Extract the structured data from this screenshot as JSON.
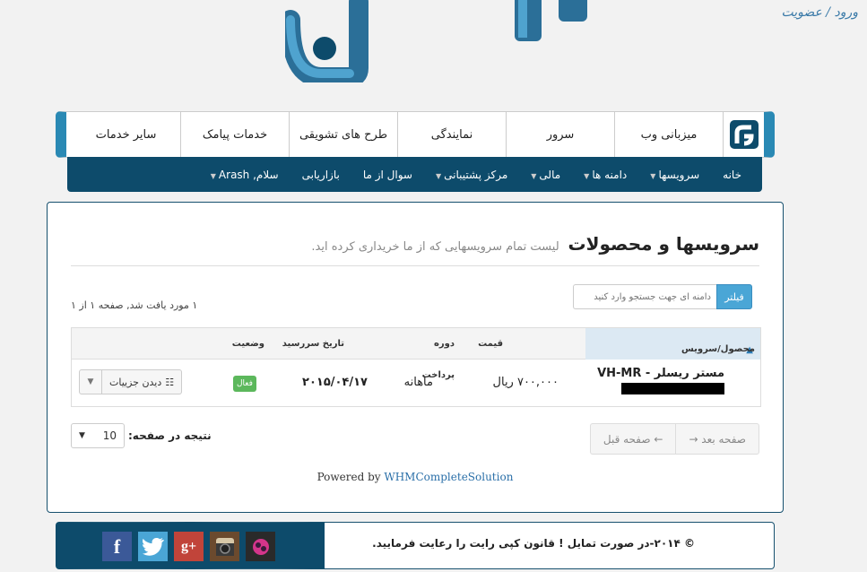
{
  "header": {
    "login_link": "ورود",
    "separator": "/",
    "register_link": "عضویت"
  },
  "nav": {
    "main": [
      "میزبانی وب",
      "سرور",
      "نمایندگی",
      "طرح های تشویقی",
      "خدمات پیامک",
      "سایر خدمات"
    ],
    "sub": [
      {
        "label": "خانه",
        "dropdown": false
      },
      {
        "label": "سرویسها",
        "dropdown": true
      },
      {
        "label": "دامنه ها",
        "dropdown": true
      },
      {
        "label": "مالی",
        "dropdown": true
      },
      {
        "label": "مرکز پشتیبانی",
        "dropdown": true
      },
      {
        "label": "سوال از ما",
        "dropdown": false
      },
      {
        "label": "بازاریابی",
        "dropdown": false
      },
      {
        "label": "سلام, Arash",
        "dropdown": true
      }
    ]
  },
  "page": {
    "title": "سرویسها و محصولات",
    "subtitle": "لیست تمام سرویسهایی که از ما خریداری کرده اید.",
    "filter_button": "فیلتر",
    "filter_placeholder": "دامنه ای جهت جستجو وارد کنید",
    "found_text": "۱ مورد یافت شد, صفحه ۱ از ۱"
  },
  "table": {
    "headers": [
      "محصول/سرویس",
      "قیمت",
      "دوره پرداخت",
      "تاریخ سررسید",
      "وضعیت"
    ],
    "rows": [
      {
        "product": "مستر ریسلر - VH-MR",
        "price": "۷۰۰,۰۰۰ ریال",
        "cycle": "ماهانه",
        "due": "۲۰۱۵/۰۴/۱۷",
        "status": "فعال",
        "action": "دیدن جزییات"
      }
    ]
  },
  "pagination": {
    "prev": "← صفحه قبل",
    "next": "صفحه بعد →"
  },
  "per_page": {
    "label": "نتیجه در صفحه:",
    "value": "10"
  },
  "powered": {
    "prefix": "Powered by",
    "link": "WHMCompleteSolution"
  },
  "footer": {
    "copyright": "© ۲۰۱۴-در صورت تمایل ! قانون کپی رایت را رعایت فرمایید."
  },
  "colors": {
    "nav_dark": "#0d4b6b",
    "accent": "#2a89b4",
    "status_active": "#5cb85c"
  }
}
